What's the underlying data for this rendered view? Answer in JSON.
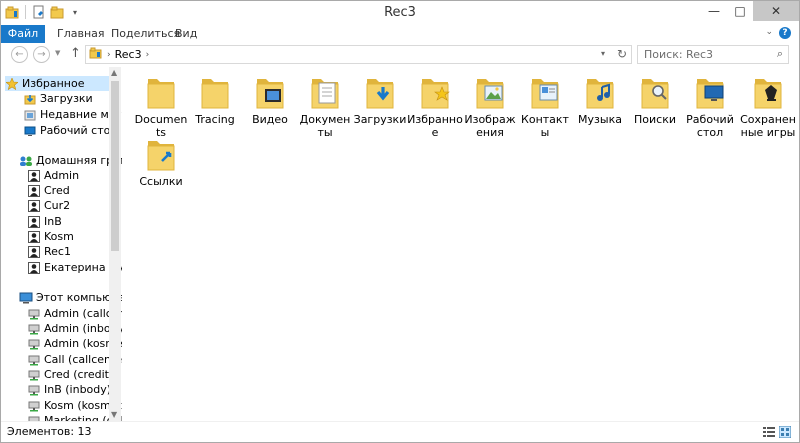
{
  "window": {
    "title": "Rec3"
  },
  "ribbon": {
    "tabs": [
      "Файл",
      "Главная",
      "Поделиться",
      "Вид"
    ]
  },
  "nav": {
    "path_segment": "Rec3",
    "search_placeholder": "Поиск: Rec3"
  },
  "sidebar": {
    "favorites_header": "Избранное",
    "favorites": [
      "Загрузки",
      "Недавние места",
      "Рабочий стол"
    ],
    "homegroup_header": "Домашняя группа",
    "homegroup": [
      "Admin",
      "Cred",
      "Cur2",
      "InB",
      "Kosm",
      "Rec1",
      "Екатерина Путин"
    ],
    "computer_header": "Этот компьютер",
    "computer": [
      "Admin (callcenter",
      "Admin (inbody)",
      "Admin (kosmeto",
      "Call (callcenter)",
      "Cred (credit)",
      "InB (inbody)",
      "Kosm (kosmetol",
      "Marketing (callce"
    ]
  },
  "folders": [
    {
      "label": "Documents",
      "overlay": "none"
    },
    {
      "label": "Tracing",
      "overlay": "none"
    },
    {
      "label": "Видео",
      "overlay": "film"
    },
    {
      "label": "Документы",
      "overlay": "doc"
    },
    {
      "label": "Загрузки",
      "overlay": "download"
    },
    {
      "label": "Избранное",
      "overlay": "star"
    },
    {
      "label": "Изображения",
      "overlay": "image"
    },
    {
      "label": "Контакты",
      "overlay": "contact"
    },
    {
      "label": "Музыка",
      "overlay": "music"
    },
    {
      "label": "Поиски",
      "overlay": "search"
    },
    {
      "label": "Рабочий стол",
      "overlay": "desktop"
    },
    {
      "label": "Сохраненные игры",
      "overlay": "games"
    },
    {
      "label": "Ссылки",
      "overlay": "link"
    }
  ],
  "status": {
    "items_count": "Элементов: 13"
  },
  "colors": {
    "accent": "#1979ca",
    "folder": "#f5d36a",
    "folder_dark": "#e0b43c"
  }
}
